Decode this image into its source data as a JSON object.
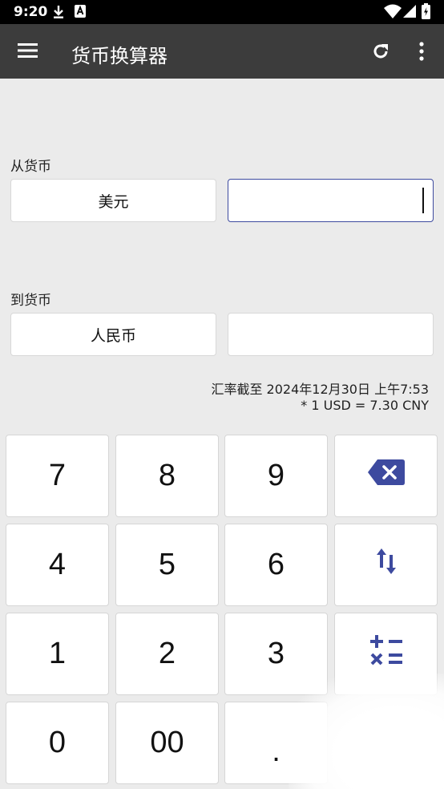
{
  "status_bar": {
    "time": "9:20",
    "icons": [
      "download-icon",
      "app-notification-icon",
      "wifi-icon",
      "signal-icon",
      "battery-icon"
    ]
  },
  "app_bar": {
    "title": "货币换算器",
    "icons": [
      "menu-icon",
      "refresh-icon",
      "more-vert-icon"
    ]
  },
  "from": {
    "label": "从货币",
    "currency": "美元",
    "value": ""
  },
  "to": {
    "label": "到货币",
    "currency": "人民币",
    "value": ""
  },
  "rate_info": {
    "updated": "汇率截至 2024年12月30日 上午7:53",
    "rate": "* 1 USD = 7.30 CNY"
  },
  "keypad": {
    "k7": "7",
    "k8": "8",
    "k9": "9",
    "k4": "4",
    "k5": "5",
    "k6": "6",
    "k1": "1",
    "k2": "2",
    "k3": "3",
    "k0": "0",
    "k00": "00",
    "kdot": ".",
    "icons": [
      "backspace-icon",
      "swap-icon",
      "calculator-icon"
    ]
  },
  "colors": {
    "accent": "#3d4a9f",
    "app_bar": "#3c3c3c",
    "background": "#ebebeb"
  }
}
